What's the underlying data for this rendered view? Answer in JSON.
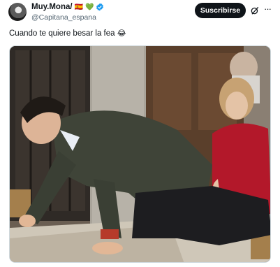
{
  "author": {
    "display_name": "Muy.Mona/",
    "flag_emoji": "🇪🇸",
    "heart_emoji": "💚",
    "handle": "@Capitana_espana"
  },
  "actions": {
    "follow_label": "Suscribirse",
    "more_label": "···"
  },
  "tweet": {
    "text": "Cuando te quiere besar la fea",
    "emoji": "😂"
  },
  "colors": {
    "verified": "#1d9bf0",
    "button_bg": "#0f1419",
    "secondary_text": "#536471"
  }
}
